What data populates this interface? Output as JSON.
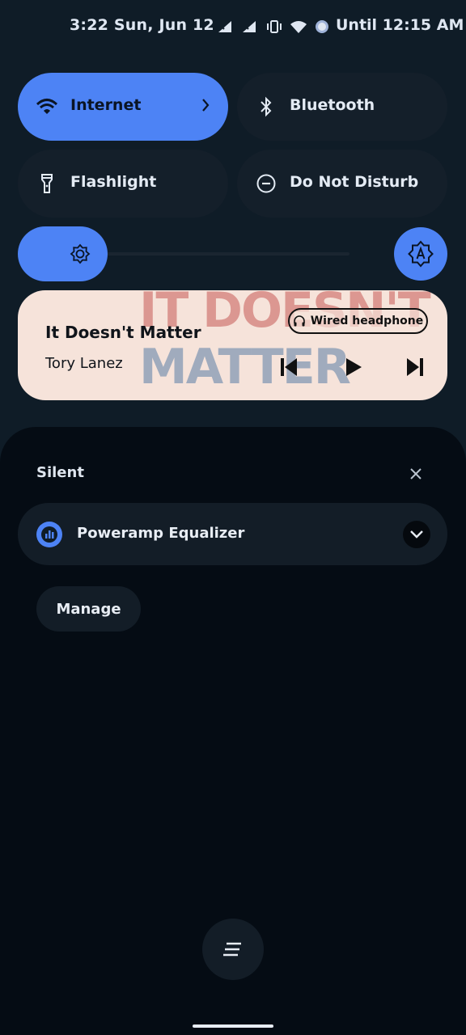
{
  "status_bar": {
    "time_date": "3:22 Sun, Jun 12",
    "icons": [
      "signal-1-icon",
      "signal-2-icon",
      "vibrate-icon",
      "wifi-icon",
      "alarm-dot-icon"
    ],
    "until_text": "Until 12:15 AM"
  },
  "tiles": {
    "internet": {
      "label": "Internet",
      "icon": "wifi-icon",
      "state": "on"
    },
    "bluetooth": {
      "label": "Bluetooth",
      "icon": "bluetooth-icon",
      "state": "off"
    },
    "flashlight": {
      "label": "Flashlight",
      "icon": "flashlight-icon",
      "state": "off"
    },
    "dnd": {
      "label": "Do Not Disturb",
      "icon": "do-not-disturb-icon",
      "state": "off"
    }
  },
  "brightness": {
    "level_fraction": 0.27,
    "auto_icon": "auto-brightness-icon"
  },
  "media": {
    "title": "It Doesn't Matter",
    "artist": "Tory Lanez",
    "output_device": "Wired headphone",
    "art_line1": "IT DOESN'T",
    "art_line2": "MATTER"
  },
  "notifications": {
    "section_title": "Silent",
    "items": [
      {
        "app_name": "Poweramp Equalizer",
        "icon": "equalizer-icon"
      }
    ],
    "manage_label": "Manage"
  },
  "colors": {
    "accent": "#4d83f5",
    "shade_bg": "#050c14",
    "panel_bg": "#0f1c27",
    "media_bg": "#f6e3da"
  }
}
